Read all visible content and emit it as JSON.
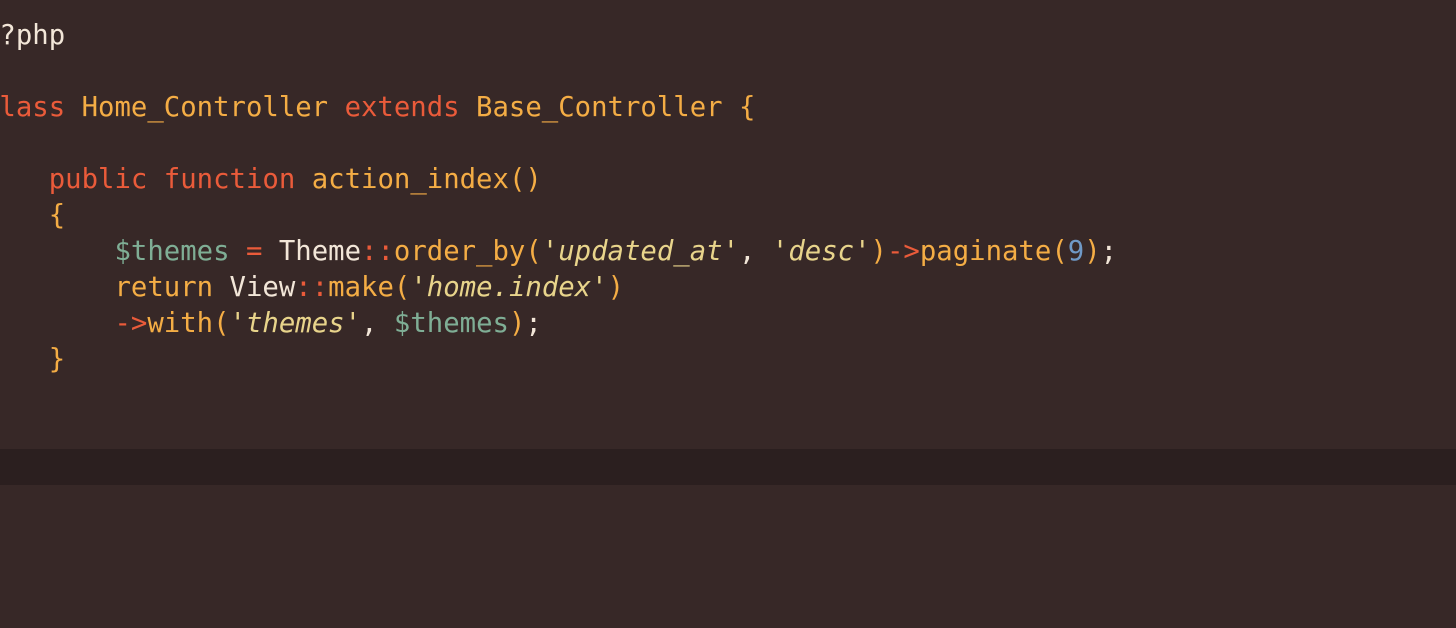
{
  "editor": {
    "lines": [
      [
        {
          "t": "<?php",
          "c": "plain"
        }
      ],
      [],
      [
        {
          "t": "class",
          "c": "kw"
        },
        {
          "t": " ",
          "c": "plain"
        },
        {
          "t": "Home_Controller",
          "c": "cls"
        },
        {
          "t": " ",
          "c": "plain"
        },
        {
          "t": "extends",
          "c": "kw"
        },
        {
          "t": " ",
          "c": "plain"
        },
        {
          "t": "Base_Controller",
          "c": "cls"
        },
        {
          "t": " ",
          "c": "plain"
        },
        {
          "t": "{",
          "c": "punc"
        }
      ],
      [],
      [
        {
          "t": "    ",
          "c": "plain"
        },
        {
          "t": "public",
          "c": "kw"
        },
        {
          "t": " ",
          "c": "plain"
        },
        {
          "t": "function",
          "c": "kw"
        },
        {
          "t": " ",
          "c": "plain"
        },
        {
          "t": "action_index",
          "c": "fn"
        },
        {
          "t": "()",
          "c": "punc"
        }
      ],
      [
        {
          "t": "    ",
          "c": "plain"
        },
        {
          "t": "{",
          "c": "punc"
        }
      ],
      [
        {
          "t": "        ",
          "c": "plain"
        },
        {
          "t": "$themes",
          "c": "var"
        },
        {
          "t": " ",
          "c": "plain"
        },
        {
          "t": "=",
          "c": "op"
        },
        {
          "t": " ",
          "c": "plain"
        },
        {
          "t": "Theme",
          "c": "plain"
        },
        {
          "t": "::",
          "c": "op"
        },
        {
          "t": "order_by",
          "c": "fn"
        },
        {
          "t": "(",
          "c": "punc"
        },
        {
          "t": "'updated_at'",
          "c": "str"
        },
        {
          "t": ", ",
          "c": "plain"
        },
        {
          "t": "'desc'",
          "c": "str"
        },
        {
          "t": ")",
          "c": "punc"
        },
        {
          "t": "->",
          "c": "op"
        },
        {
          "t": "paginate",
          "c": "fn"
        },
        {
          "t": "(",
          "c": "punc"
        },
        {
          "t": "9",
          "c": "num"
        },
        {
          "t": ")",
          "c": "punc"
        },
        {
          "t": ";",
          "c": "plain"
        }
      ],
      [
        {
          "t": "        ",
          "c": "plain"
        },
        {
          "t": "return",
          "c": "fn"
        },
        {
          "t": " ",
          "c": "plain"
        },
        {
          "t": "View",
          "c": "plain"
        },
        {
          "t": "::",
          "c": "op"
        },
        {
          "t": "make",
          "c": "fn"
        },
        {
          "t": "(",
          "c": "punc"
        },
        {
          "t": "'home.index'",
          "c": "str"
        },
        {
          "t": ")",
          "c": "punc"
        }
      ],
      [
        {
          "t": "        ",
          "c": "plain"
        },
        {
          "t": "->",
          "c": "op"
        },
        {
          "t": "with",
          "c": "fn"
        },
        {
          "t": "(",
          "c": "punc"
        },
        {
          "t": "'themes'",
          "c": "str"
        },
        {
          "t": ", ",
          "c": "plain"
        },
        {
          "t": "$themes",
          "c": "var"
        },
        {
          "t": ")",
          "c": "punc"
        },
        {
          "t": ";",
          "c": "plain"
        }
      ],
      [
        {
          "t": "    ",
          "c": "plain"
        },
        {
          "t": "}",
          "c": "punc"
        }
      ],
      [],
      [],
      [],
      [],
      [],
      []
    ],
    "colors": {
      "background": "#372827",
      "current_line": "#2b1f1f",
      "keyword": "#ea5b3a",
      "class_name": "#f4ad45",
      "variable": "#7fae95",
      "string": "#e8d48b",
      "number": "#6f99c7",
      "text": "#f2e6d8"
    }
  }
}
